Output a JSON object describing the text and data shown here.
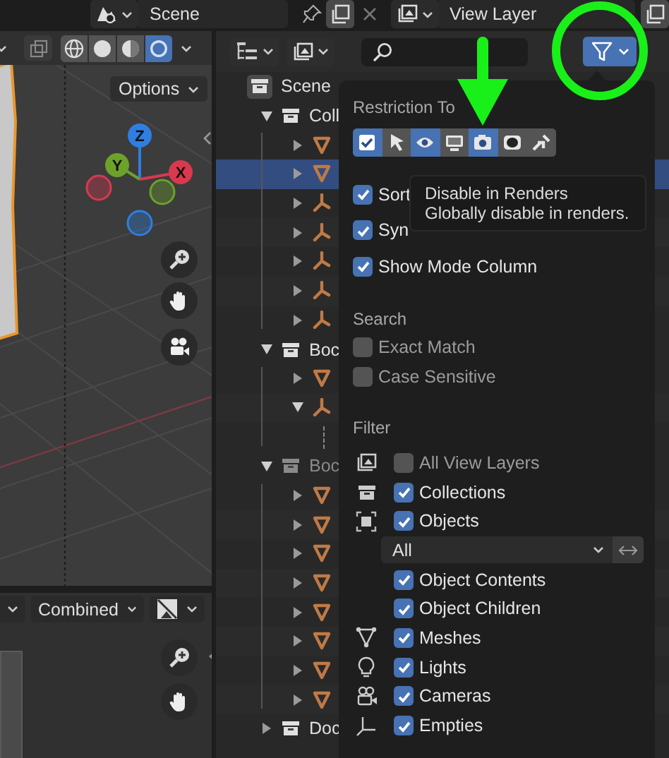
{
  "top_bar": {
    "scene": "Scene",
    "view_layer": "View Layer"
  },
  "viewport": {
    "shading": [
      {
        "kind": "wireframe",
        "selected": false
      },
      {
        "kind": "solid",
        "selected": false
      },
      {
        "kind": "material",
        "selected": false
      },
      {
        "kind": "rendered",
        "selected": true
      }
    ],
    "options": "Options",
    "gizmo": [
      {
        "label": "Z",
        "color": "#2f7ee0"
      },
      {
        "label": "Y",
        "color": "#6da22a"
      },
      {
        "label": "X",
        "color": "#d8394f"
      }
    ]
  },
  "image_editor": {
    "pass": "Combined"
  },
  "outliner": {
    "tree": [
      {
        "kind": "scene",
        "label": "Scene",
        "selected": false,
        "children": [
          {
            "kind": "collection",
            "label": "Coll",
            "expanded": true,
            "excluded": false,
            "selected": false,
            "children": [
              {
                "kind": "mesh",
                "expanded": false,
                "selected": false
              },
              {
                "kind": "mesh",
                "expanded": false,
                "selected": true
              },
              {
                "kind": "empty",
                "expanded": false,
                "selected": false
              },
              {
                "kind": "empty",
                "expanded": false,
                "selected": false
              },
              {
                "kind": "empty",
                "expanded": false,
                "selected": false
              },
              {
                "kind": "empty",
                "expanded": false,
                "selected": false
              },
              {
                "kind": "empty",
                "expanded": false,
                "selected": false
              }
            ]
          },
          {
            "kind": "collection",
            "label": "Boc",
            "expanded": true,
            "excluded": false,
            "selected": false,
            "children": [
              {
                "kind": "mesh",
                "expanded": false,
                "selected": false
              },
              {
                "kind": "empty",
                "expanded": true,
                "selected": false
              }
            ]
          },
          {
            "kind": "collection",
            "label": "Boc",
            "expanded": true,
            "excluded": true,
            "selected": false,
            "children": [
              {
                "kind": "mesh",
                "expanded": false,
                "selected": false
              },
              {
                "kind": "mesh",
                "expanded": false,
                "selected": false
              },
              {
                "kind": "mesh",
                "expanded": false,
                "selected": false
              },
              {
                "kind": "mesh",
                "expanded": false,
                "selected": false
              },
              {
                "kind": "mesh",
                "expanded": false,
                "selected": false
              },
              {
                "kind": "mesh",
                "expanded": false,
                "selected": false
              },
              {
                "kind": "mesh",
                "expanded": false,
                "selected": false
              },
              {
                "kind": "mesh",
                "expanded": false,
                "selected": false
              }
            ]
          },
          {
            "kind": "collection",
            "label": "Doc",
            "expanded": false,
            "excluded": false,
            "selected": false
          }
        ]
      }
    ]
  },
  "filter_popup": {
    "restriction": {
      "title": "Restriction To",
      "toggles": [
        {
          "kind": "checkbox",
          "on": true
        },
        {
          "kind": "select",
          "on": false
        },
        {
          "kind": "eye",
          "on": true
        },
        {
          "kind": "viewport",
          "on": false
        },
        {
          "kind": "render",
          "on": true
        },
        {
          "kind": "holdout",
          "on": false
        },
        {
          "kind": "indirect",
          "on": false
        }
      ]
    },
    "options": [
      {
        "label": "Sort",
        "checked": true
      },
      {
        "label": "Syn",
        "checked": true
      },
      {
        "label": "Show Mode Column",
        "checked": true
      }
    ],
    "search": {
      "title": "Search",
      "options": [
        {
          "label": "Exact Match",
          "checked": false
        },
        {
          "label": "Case Sensitive",
          "checked": false
        }
      ]
    },
    "filter": {
      "title": "Filter",
      "items": [
        {
          "kind": "view_layers",
          "label": "All View Layers",
          "checked": false
        },
        {
          "kind": "collections",
          "label": "Collections",
          "checked": true
        },
        {
          "kind": "objects",
          "label": "Objects",
          "checked": true
        },
        {
          "kind": "select",
          "value": "All"
        },
        {
          "kind": "sub",
          "label": "Object Contents",
          "checked": true
        },
        {
          "kind": "sub",
          "label": "Object Children",
          "checked": true
        },
        {
          "kind": "meshes",
          "label": "Meshes",
          "checked": true
        },
        {
          "kind": "lights",
          "label": "Lights",
          "checked": true
        },
        {
          "kind": "cameras",
          "label": "Cameras",
          "checked": true
        },
        {
          "kind": "empties",
          "label": "Empties",
          "checked": true
        }
      ]
    }
  },
  "tooltip": {
    "title": "Disable in Renders",
    "description": "Globally disable in renders."
  }
}
